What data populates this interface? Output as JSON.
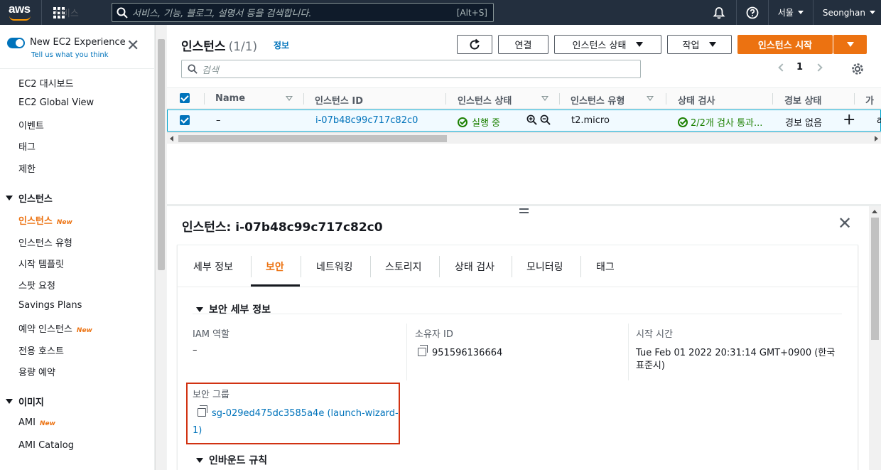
{
  "topnav": {
    "logo": "aws",
    "services_label": "서비스",
    "search_placeholder": "서비스, 기능, 블로그, 설명서 등을 검색합니다.",
    "search_shortcut": "[Alt+S]",
    "region": "서울",
    "user": "Seonghan"
  },
  "sidebar": {
    "new_experience_title": "New EC2 Experience",
    "new_experience_sub": "Tell us what you think",
    "top_items": [
      "EC2 대시보드",
      "EC2 Global View",
      "이벤트",
      "태그",
      "제한"
    ],
    "section_instances": "인스턴스",
    "instances_items": [
      "인스턴스",
      "인스턴스 유형",
      "시작 템플릿",
      "스팟 요청",
      "Savings Plans",
      "예약 인스턴스",
      "전용 호스트",
      "용량 예약"
    ],
    "section_images": "이미지",
    "images_items": [
      "AMI",
      "AMI Catalog"
    ],
    "new_badge": "New"
  },
  "instances": {
    "title": "인스턴스",
    "count": "(1/1)",
    "info": "정보",
    "buttons": {
      "connect": "연결",
      "state": "인스턴스 상태",
      "actions": "작업",
      "launch": "인스턴스 시작"
    },
    "search_placeholder": "검색",
    "page": "1",
    "columns": [
      "Name",
      "인스턴스 ID",
      "인스턴스 상태",
      "인스턴스 유형",
      "상태 검사",
      "경보 상태",
      "가"
    ],
    "row": {
      "name": "–",
      "id": "i-07b48c99c717c82c0",
      "state": "실행 중",
      "type": "t2.micro",
      "checks": "2/2개 검사 통과...",
      "alarm": "경보 없음",
      "extra": "a"
    }
  },
  "details": {
    "title": "인스턴스: i-07b48c99c717c82c0",
    "tabs": [
      "세부 정보",
      "보안",
      "네트워킹",
      "스토리지",
      "상태 검사",
      "모니터링",
      "태그"
    ],
    "section_security": "보안 세부 정보",
    "iam_label": "IAM 역할",
    "iam_value": "–",
    "owner_label": "소유자 ID",
    "owner_value": "951596136664",
    "launch_label": "시작 시간",
    "launch_value_1": "Tue Feb 01 2022 20:31:14 GMT+0900 (한국",
    "launch_value_2": "표준시)",
    "sg_label": "보안 그룹",
    "sg_value_1": "sg-029ed475dc3585a4e (launch-wizard-",
    "sg_value_2": "1)",
    "section_inbound": "인바운드 규칙"
  },
  "colors": {
    "nav_bg": "#232f3e",
    "accent_orange": "#ec7211",
    "link_blue": "#0073bb",
    "success_green": "#1d8102",
    "highlight_red": "#d13212"
  }
}
